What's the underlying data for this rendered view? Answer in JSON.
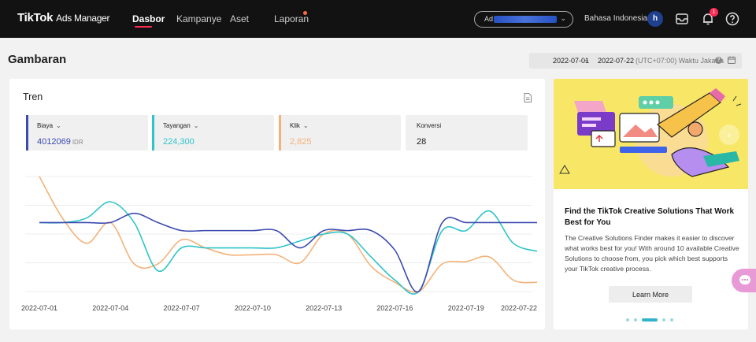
{
  "topbar": {
    "logo_main": "TikTok",
    "logo_sub": "Ads Manager",
    "nav": [
      {
        "label": "Dasbor",
        "active": true
      },
      {
        "label": "Kampanye",
        "active": false
      },
      {
        "label": "Aset",
        "active": false
      },
      {
        "label": "Laporan",
        "active": false
      }
    ],
    "account_prefix": "Ad",
    "language": "Bahasa Indonesia",
    "avatar_initial": "h",
    "notifications_count": "1",
    "icons": [
      "inbox-icon",
      "bell-icon",
      "help-icon"
    ]
  },
  "page": {
    "title": "Gambaran",
    "date_start": "2022-07-01",
    "date_sep": "~",
    "date_end": "2022-07-22",
    "timezone": "(UTC+07:00) Waktu Jakarta"
  },
  "trend": {
    "title": "Tren",
    "metrics": [
      {
        "name": "Biaya",
        "value": "4012069",
        "unit": "IDR",
        "color": "#3c4bb0",
        "has_dropdown": true
      },
      {
        "name": "Tayangan",
        "value": "224,300",
        "unit": "",
        "color": "#2ec4c9",
        "has_dropdown": true
      },
      {
        "name": "Klik",
        "value": "2,825",
        "unit": "",
        "color": "#f3b27a",
        "has_dropdown": true
      },
      {
        "name": "Konversi",
        "value": "28",
        "unit": "",
        "color": "#222222",
        "has_dropdown": false
      }
    ]
  },
  "chart_data": {
    "type": "line",
    "x": [
      "2022-07-01",
      "2022-07-02",
      "2022-07-03",
      "2022-07-04",
      "2022-07-05",
      "2022-07-06",
      "2022-07-07",
      "2022-07-08",
      "2022-07-09",
      "2022-07-10",
      "2022-07-11",
      "2022-07-12",
      "2022-07-13",
      "2022-07-14",
      "2022-07-15",
      "2022-07-16",
      "2022-07-17",
      "2022-07-18",
      "2022-07-19",
      "2022-07-20",
      "2022-07-21",
      "2022-07-22"
    ],
    "x_tick_labels": [
      "2022-07-01",
      "2022-07-04",
      "2022-07-07",
      "2022-07-10",
      "2022-07-13",
      "2022-07-16",
      "2022-07-19",
      "2022-07-22"
    ],
    "y_scale": "normalized per series (no y-axis labels shown)",
    "ylim": [
      0,
      100
    ],
    "grid": true,
    "series": [
      {
        "name": "Biaya",
        "color": "#3c4bb0",
        "values": [
          60,
          60,
          60,
          60,
          68,
          60,
          53,
          53,
          53,
          53,
          53,
          38,
          53,
          53,
          53,
          36,
          0,
          60,
          60,
          60,
          60,
          60
        ]
      },
      {
        "name": "Tayangan",
        "color": "#2ec4c9",
        "values": [
          60,
          60,
          64,
          78,
          60,
          18,
          38,
          38,
          38,
          38,
          38,
          44,
          50,
          50,
          30,
          10,
          0,
          53,
          53,
          70,
          42,
          35
        ]
      },
      {
        "name": "Klik",
        "color": "#f3b27a",
        "values": [
          100,
          63,
          42,
          60,
          24,
          24,
          45,
          38,
          32,
          32,
          32,
          25,
          50,
          50,
          22,
          8,
          0,
          24,
          26,
          30,
          10,
          8
        ]
      }
    ]
  },
  "promo": {
    "title": "Find the TikTok Creative Solutions That Work Best for You",
    "body": "The Creative Solutions Finder makes it easier to discover what works best for you! With around 10 available Creative Solutions to choose from, you pick which best supports your TikTok creative process.",
    "button": "Learn More",
    "slide_count": 5,
    "active_slide": 2
  }
}
